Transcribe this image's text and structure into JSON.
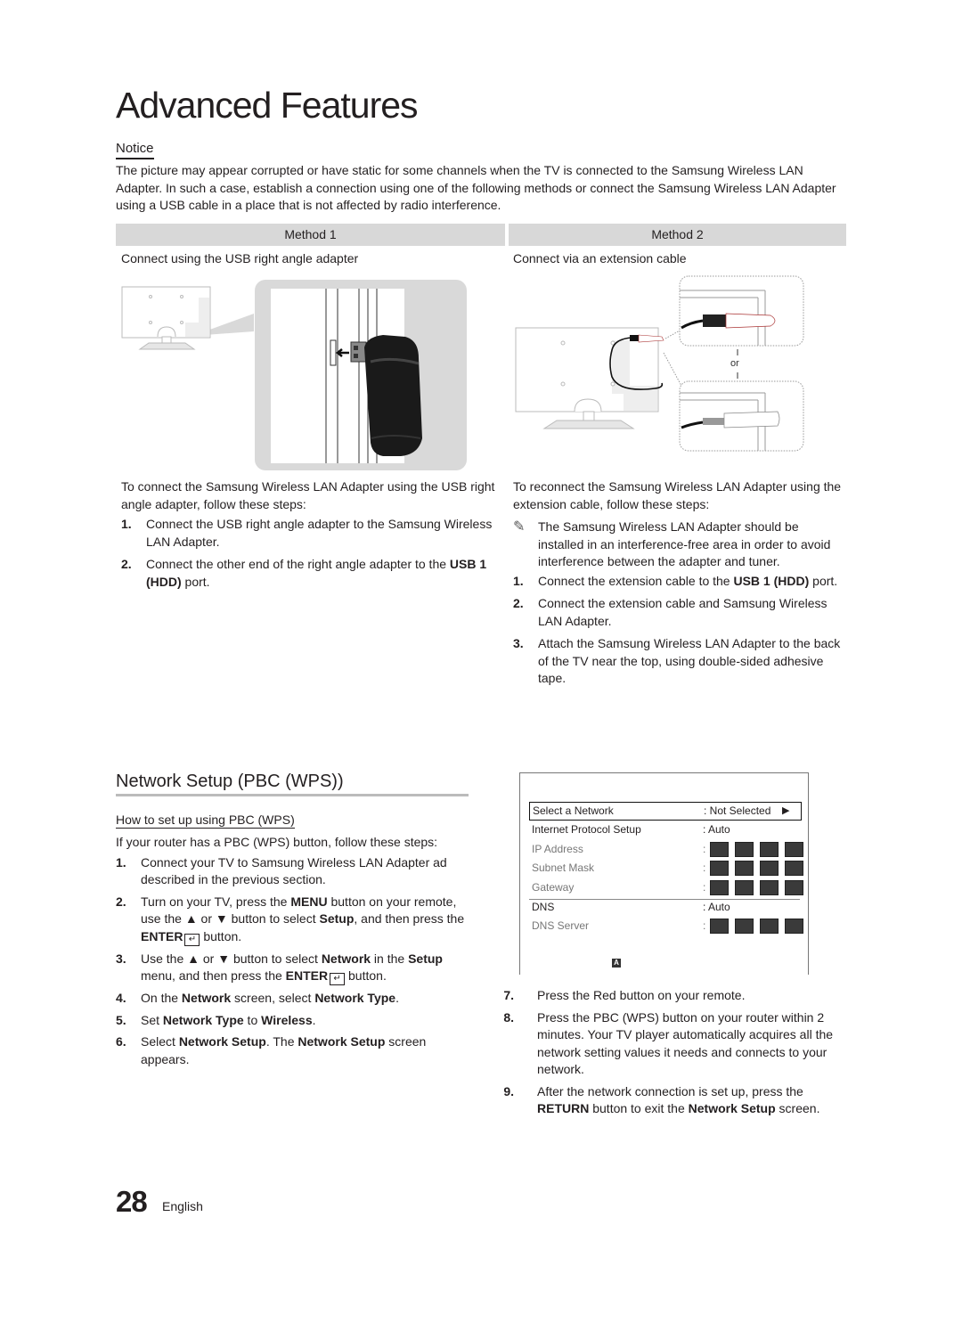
{
  "page": {
    "title": "Advanced Features",
    "number": "28",
    "language": "English"
  },
  "notice": {
    "heading": "Notice",
    "text": "The picture may appear corrupted or have static for some channels when the TV is connected to the Samsung Wireless LAN Adapter. In such a case, establish a connection using one of the following methods or connect the Samsung Wireless LAN Adapter using a USB cable in a place that is not affected by radio interference."
  },
  "method1": {
    "heading": "Method 1",
    "subtitle": "Connect using the USB right angle adapter",
    "intro": "To connect the Samsung Wireless LAN Adapter using the USB right angle adapter, follow these steps:",
    "steps": [
      {
        "num": "1.",
        "text": "Connect the USB right angle adapter to the Samsung Wireless LAN Adapter."
      },
      {
        "num": "2.",
        "pre": "Connect the other end of the right angle adapter to the ",
        "bold": "USB 1 (HDD)",
        "post": " port."
      }
    ]
  },
  "method2": {
    "heading": "Method 2",
    "subtitle": "Connect via an extension cable",
    "or_label": "or",
    "intro": "To reconnect the Samsung Wireless LAN Adapter using the extension cable, follow these steps:",
    "note": "The Samsung Wireless LAN Adapter should be installed in an interference-free area in order to avoid interference between the adapter and tuner.",
    "note_icon": "✎",
    "steps": [
      {
        "num": "1.",
        "pre": "Connect the extension cable to the ",
        "bold": "USB 1 (HDD)",
        "post": " port."
      },
      {
        "num": "2.",
        "text": "Connect the extension cable and Samsung Wireless LAN Adapter."
      },
      {
        "num": "3.",
        "text": "Attach the Samsung Wireless LAN Adapter to the back of the TV near the top, using double-sided adhesive tape."
      }
    ]
  },
  "network_setup": {
    "heading": "Network Setup (PBC (WPS))",
    "subheading": "How to set up using PBC (WPS)",
    "intro": "If your router has a PBC (WPS) button, follow these steps:",
    "enter_glyph": "↵",
    "steps": {
      "s1": {
        "num": "1.",
        "text": "Connect your TV to Samsung Wireless LAN Adapter ad described in the previous section."
      },
      "s2": {
        "num": "2.",
        "a": "Turn on your TV, press the ",
        "b1": "MENU",
        "c": " button on your remote, use the ▲ or ▼ button to select ",
        "b2": "Setup",
        "d": ", and then press the ",
        "b3": "ENTER",
        "e": " button."
      },
      "s3": {
        "num": "3.",
        "a": "Use the ▲ or ▼ button to select ",
        "b1": "Network",
        "c": " in the ",
        "b2": "Setup",
        "d": " menu, and then press the ",
        "b3": "ENTER",
        "e": " button."
      },
      "s4": {
        "num": "4.",
        "a": "On the ",
        "b1": "Network",
        "c": " screen, select ",
        "b2": "Network Type",
        "d": "."
      },
      "s5": {
        "num": "5.",
        "a": "Set ",
        "b1": "Network Type",
        "c": " to ",
        "b2": "Wireless",
        "d": "."
      },
      "s6": {
        "num": "6.",
        "a": "Select ",
        "b1": "Network Setup",
        "c": ". The ",
        "b2": "Network Setup",
        "d": " screen appears."
      },
      "s7": {
        "num": "7.",
        "text": "Press the Red button on your remote."
      },
      "s8": {
        "num": "8.",
        "text": "Press the PBC (WPS) button on your router within 2 minutes. Your TV player automatically acquires all the network setting values it needs and connects to your network."
      },
      "s9": {
        "num": "9.",
        "a": "After the network connection is set up, press the ",
        "b1": "RETURN",
        "c": " button to exit the ",
        "b2": "Network Setup",
        "d": " screen."
      }
    },
    "screen": {
      "rows": [
        {
          "label": "Select a Network",
          "value": ": Not Selected",
          "arrow": "▶"
        },
        {
          "label": "Internet Protocol Setup",
          "value": ": Auto"
        },
        {
          "label": "IP Address",
          "value": ":"
        },
        {
          "label": "Subnet Mask",
          "value": ":"
        },
        {
          "label": "Gateway",
          "value": ":"
        },
        {
          "label": "DNS",
          "value": ": Auto"
        },
        {
          "label": "DNS Server",
          "value": ":"
        }
      ],
      "badge": "A"
    }
  }
}
